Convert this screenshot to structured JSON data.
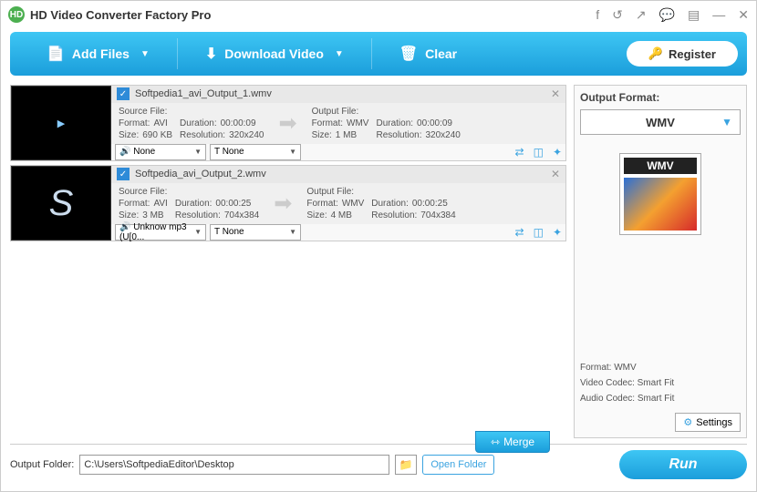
{
  "app": {
    "title": "HD Video Converter Factory Pro"
  },
  "toolbar": {
    "add_files": "Add Files",
    "download_video": "Download Video",
    "clear": "Clear",
    "register": "Register"
  },
  "files": [
    {
      "name": "Softpedia1_avi_Output_1.wmv",
      "source": {
        "label": "Source File:",
        "format_label": "Format:",
        "format": "AVI",
        "duration_label": "Duration:",
        "duration": "00:00:09",
        "size_label": "Size:",
        "size": "690 KB",
        "resolution_label": "Resolution:",
        "resolution": "320x240"
      },
      "output": {
        "label": "Output File:",
        "format_label": "Format:",
        "format": "WMV",
        "duration_label": "Duration:",
        "duration": "00:00:09",
        "size_label": "Size:",
        "size": "1 MB",
        "resolution_label": "Resolution:",
        "resolution": "320x240"
      },
      "audio_sel": "🔊 None",
      "text_sel": "T None"
    },
    {
      "name": "Softpedia_avi_Output_2.wmv",
      "source": {
        "label": "Source File:",
        "format_label": "Format:",
        "format": "AVI",
        "duration_label": "Duration:",
        "duration": "00:00:25",
        "size_label": "Size:",
        "size": "3 MB",
        "resolution_label": "Resolution:",
        "resolution": "704x384"
      },
      "output": {
        "label": "Output File:",
        "format_label": "Format:",
        "format": "WMV",
        "duration_label": "Duration:",
        "duration": "00:00:25",
        "size_label": "Size:",
        "size": "4 MB",
        "resolution_label": "Resolution:",
        "resolution": "704x384"
      },
      "audio_sel": "🔊 Unknow mp3 (U[0...",
      "text_sel": "T None"
    }
  ],
  "output_panel": {
    "title": "Output Format:",
    "selected": "WMV",
    "thumb_label": "WMV",
    "format_label": "Format:",
    "format_value": "WMV",
    "video_codec_label": "Video Codec:",
    "video_codec_value": "Smart Fit",
    "audio_codec_label": "Audio Codec:",
    "audio_codec_value": "Smart Fit",
    "settings": "Settings"
  },
  "bottom": {
    "merge": "Merge",
    "output_folder_label": "Output Folder:",
    "output_folder_value": "C:\\Users\\SoftpediaEditor\\Desktop",
    "open_folder": "Open Folder",
    "run": "Run"
  }
}
